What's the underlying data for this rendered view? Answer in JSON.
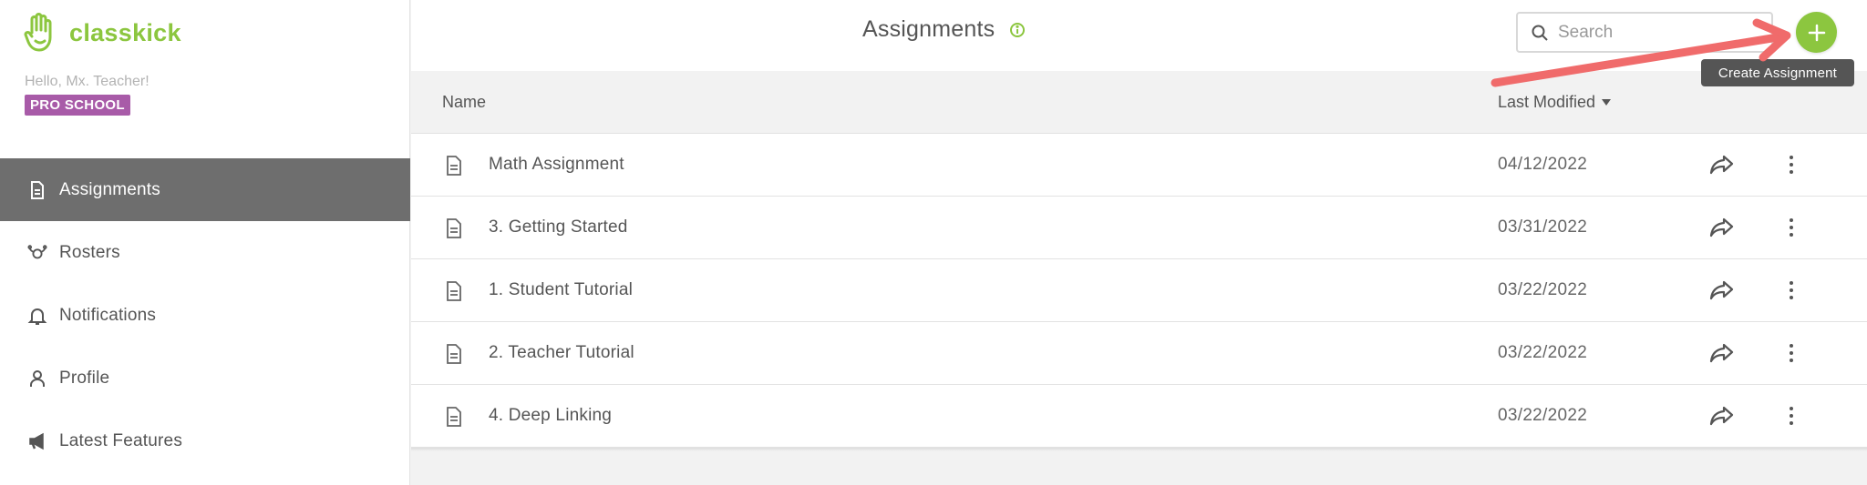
{
  "app": {
    "logo_text": "classkick",
    "greeting": "Hello, Mx. Teacher!",
    "plan_badge": "PRO SCHOOL",
    "brand_color": "#8cc63f",
    "badge_color": "#a85ba8"
  },
  "sidebar": {
    "items": [
      {
        "label": "Assignments",
        "icon": "document-icon",
        "active": true
      },
      {
        "label": "Rosters",
        "icon": "roster-icon",
        "active": false
      },
      {
        "label": "Notifications",
        "icon": "bell-icon",
        "active": false
      },
      {
        "label": "Profile",
        "icon": "person-icon",
        "active": false
      },
      {
        "label": "Latest Features",
        "icon": "megaphone-icon",
        "active": false
      }
    ]
  },
  "header": {
    "title": "Assignments",
    "search_placeholder": "Search",
    "search_value": "",
    "add_tooltip": "Create Assignment"
  },
  "table": {
    "columns": {
      "name": "Name",
      "modified": "Last Modified"
    },
    "rows": [
      {
        "name": "Math Assignment",
        "date": "04/12/2022"
      },
      {
        "name": "3. Getting Started",
        "date": "03/31/2022"
      },
      {
        "name": "1. Student Tutorial",
        "date": "03/22/2022"
      },
      {
        "name": "2. Teacher Tutorial",
        "date": "03/22/2022"
      },
      {
        "name": "4. Deep Linking",
        "date": "03/22/2022"
      }
    ]
  },
  "annotation": {
    "arrow_color": "#f06b6b"
  }
}
